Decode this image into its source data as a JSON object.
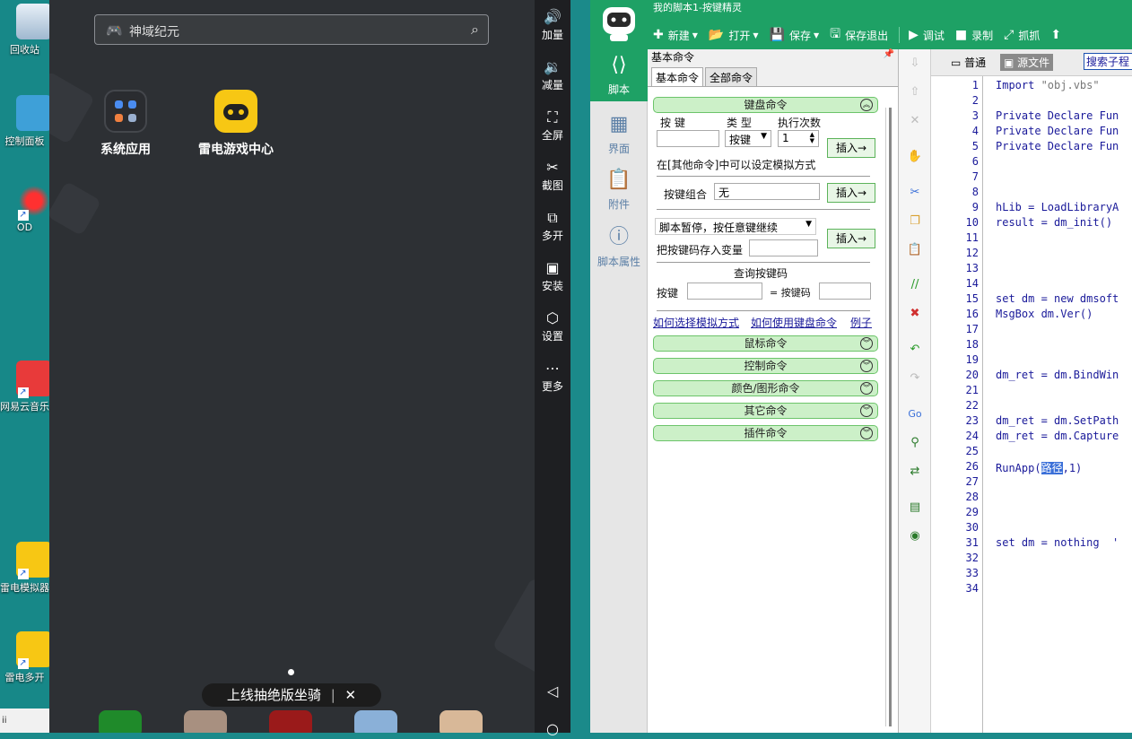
{
  "desktop": {
    "icons": [
      {
        "label": "回收站"
      },
      {
        "label": "控制面板"
      },
      {
        "label": "OD"
      },
      {
        "label": "网易云音乐"
      },
      {
        "label": "雷电模拟器"
      },
      {
        "label": "雷电多开"
      }
    ],
    "taskbar_text": "ii"
  },
  "emulator": {
    "search_placeholder": "神域纪元",
    "apps": [
      {
        "label": "系统应用"
      },
      {
        "label": "雷电游戏中心"
      }
    ],
    "banner_text": "上线抽绝版坐骑",
    "banner_close": "✕",
    "sidebar": [
      {
        "label": "加量",
        "icon": "volume-up-icon"
      },
      {
        "label": "减量",
        "icon": "volume-down-icon"
      },
      {
        "label": "全屏",
        "icon": "fullscreen-icon"
      },
      {
        "label": "截图",
        "icon": "scissors-icon"
      },
      {
        "label": "多开",
        "icon": "multi-open-icon"
      },
      {
        "label": "安装",
        "icon": "apk-icon"
      },
      {
        "label": "设置",
        "icon": "settings-icon"
      },
      {
        "label": "更多",
        "icon": "more-icon"
      }
    ]
  },
  "editor_app": {
    "title": "我的脚本1-按键精灵",
    "toolbar": [
      {
        "label": "新建",
        "dropdown": true
      },
      {
        "label": "打开",
        "dropdown": true
      },
      {
        "label": "保存",
        "dropdown": true
      },
      {
        "label": "保存退出"
      },
      {
        "label": "调试"
      },
      {
        "label": "录制"
      },
      {
        "label": "抓抓"
      }
    ],
    "left_nav": [
      {
        "label": "脚本",
        "active": true
      },
      {
        "label": "界面"
      },
      {
        "label": "附件"
      },
      {
        "label": "脚本属性"
      }
    ],
    "panel": {
      "header": "基本命令",
      "tabs": [
        "基本命令",
        "全部命令"
      ],
      "keyboard_group": "键盘命令",
      "key_label": "按 键",
      "type_label": "类 型",
      "count_label": "执行次数",
      "type_value": "按键",
      "count_value": "1",
      "insert": "插入→",
      "hint": "在[其他命令]中可以设定模拟方式",
      "combo_label": "按键组合",
      "combo_value": "无",
      "pause_select": "脚本暂停，按任意键继续",
      "store_var_label": "把按键码存入变量",
      "query_title": "查询按键码",
      "query_key_label": "按键",
      "query_code_label": "= 按键码",
      "links": [
        "如何选择模拟方式",
        "如何使用键盘命令",
        "例子"
      ],
      "groups": [
        "鼠标命令",
        "控制命令",
        "颜色/图形命令",
        "其它命令",
        "插件命令"
      ]
    },
    "editor": {
      "tabs": [
        "普通",
        "源文件"
      ],
      "search_text": "搜索子程",
      "lines": [
        {
          "n": "1",
          "code": "Import \"obj.vbs\""
        },
        {
          "n": "2",
          "code": ""
        },
        {
          "n": "3",
          "code": "Private Declare Fun"
        },
        {
          "n": "4",
          "code": "Private Declare Fun"
        },
        {
          "n": "5",
          "code": "Private Declare Fun"
        },
        {
          "n": "6",
          "code": ""
        },
        {
          "n": "7",
          "code": ""
        },
        {
          "n": "8",
          "code": ""
        },
        {
          "n": "9",
          "code": "hLib = LoadLibraryA"
        },
        {
          "n": "10",
          "code": "result = dm_init()"
        },
        {
          "n": "11",
          "code": ""
        },
        {
          "n": "12",
          "code": ""
        },
        {
          "n": "13",
          "code": ""
        },
        {
          "n": "14",
          "code": ""
        },
        {
          "n": "15",
          "code": "set dm = new dmsoft"
        },
        {
          "n": "16",
          "code": "MsgBox dm.Ver()"
        },
        {
          "n": "17",
          "code": ""
        },
        {
          "n": "18",
          "code": ""
        },
        {
          "n": "19",
          "code": ""
        },
        {
          "n": "20",
          "code": "dm_ret = dm.BindWin"
        },
        {
          "n": "21",
          "code": ""
        },
        {
          "n": "22",
          "code": ""
        },
        {
          "n": "23",
          "code": "dm_ret = dm.SetPath"
        },
        {
          "n": "24",
          "code": "dm_ret = dm.Capture"
        },
        {
          "n": "25",
          "code": ""
        },
        {
          "n": "26",
          "code": "RunApp(路径,1)"
        },
        {
          "n": "27",
          "code": ""
        },
        {
          "n": "28",
          "code": ""
        },
        {
          "n": "29",
          "code": ""
        },
        {
          "n": "30",
          "code": ""
        },
        {
          "n": "31",
          "code": "set dm = nothing  '"
        },
        {
          "n": "32",
          "code": ""
        },
        {
          "n": "33",
          "code": ""
        },
        {
          "n": "34",
          "code": ""
        }
      ]
    }
  }
}
